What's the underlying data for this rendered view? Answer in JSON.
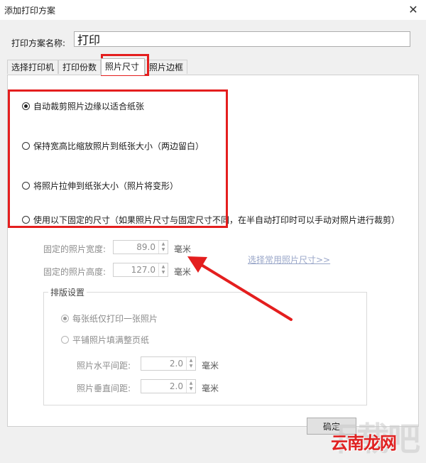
{
  "window": {
    "title": "添加打印方案",
    "close_icon": "close-icon"
  },
  "scheme": {
    "label": "打印方案名称:",
    "value": "打印"
  },
  "tabs": [
    {
      "label": "选择打印机",
      "active": false
    },
    {
      "label": "打印份数",
      "active": false
    },
    {
      "label": "照片尺寸",
      "active": true
    },
    {
      "label": "照片边框",
      "active": false
    }
  ],
  "size_options": [
    {
      "label": "自动裁剪照片边缘以适合纸张",
      "checked": true
    },
    {
      "label": "保持宽高比缩放照片到纸张大小（两边留白）",
      "checked": false
    },
    {
      "label": "将照片拉伸到纸张大小（照片将变形）",
      "checked": false
    },
    {
      "label": "使用以下固定的尺寸（如果照片尺寸与固定尺寸不同，在半自动打印时可以手动对照片进行裁剪）",
      "checked": false
    }
  ],
  "fixed": {
    "width_label": "固定的照片宽度:",
    "width_value": "89.0",
    "height_label": "固定的照片高度:",
    "height_value": "127.0",
    "unit": "毫米",
    "common_sizes_link": "选择常用照片尺寸>>"
  },
  "layout": {
    "title": "排版设置",
    "options": [
      {
        "label": "每张纸仅打印一张照片",
        "checked": true
      },
      {
        "label": "平铺照片填满整页纸",
        "checked": false
      }
    ],
    "h_spacing_label": "照片水平间距:",
    "h_spacing_value": "2.0",
    "v_spacing_label": "照片垂直间距:",
    "v_spacing_value": "2.0",
    "unit": "毫米"
  },
  "buttons": {
    "ok": "确定"
  },
  "watermark": {
    "text": "云南龙网",
    "bg_text": "下载吧"
  },
  "colors": {
    "highlight": "#e41e1e",
    "link": "#9aa7c9"
  }
}
